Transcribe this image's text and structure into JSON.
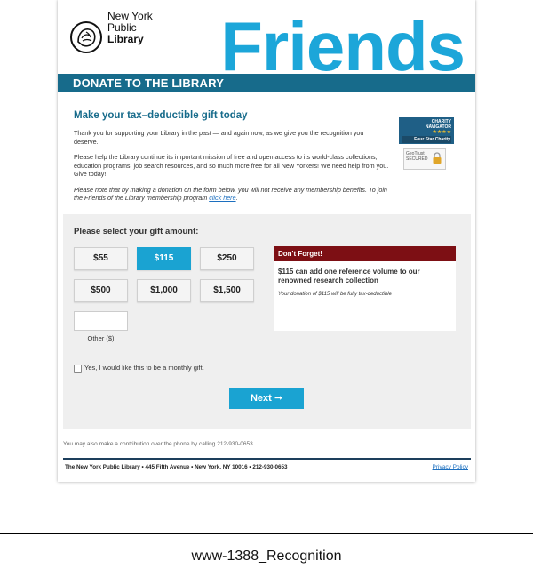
{
  "header": {
    "logo_line1": "New York",
    "logo_line2": "Public",
    "logo_line3": "Library",
    "hero_word": "Friends",
    "banner": "DONATE TO THE LIBRARY"
  },
  "intro": {
    "title": "Make your tax–deductible gift today",
    "p1": "Thank you for supporting your Library in the past — and again now, as we give you the recognition you deserve.",
    "p2": "Please help the Library continue its important mission of free and open access to its world-class collections, education programs, job search resources, and so much more free for all New Yorkers! We need help from you. Give today!",
    "note": "Please note that by making a donation on the form below, you will not receive any membership benefits. To join the Friends of the Library membership program",
    "link": "click here",
    "link_end": "."
  },
  "badges": {
    "charity_line1": "CHARITY",
    "charity_line2": "NAVIGATOR",
    "charity_stars": "★★★★",
    "charity_line3": "Four Star Charity",
    "secure_line1": "GeoTrust",
    "secure_line2": "SECURED"
  },
  "gift": {
    "title": "Please select your gift amount:",
    "amounts": [
      "$55",
      "$115",
      "$250",
      "$500",
      "$1,000",
      "$1,500"
    ],
    "selected": "$115",
    "other_label": "Other ($)",
    "monthly_label": "Yes, I would like this to be a monthly gift.",
    "next_label": "Next ➞"
  },
  "reminder": {
    "heading": "Don't Forget!",
    "message": "$115 can add one reference volume to our renowned research collection",
    "tax_note": "Your donation of $115 will be fully tax-deductible"
  },
  "footer": {
    "phone": "You may also make a contribution over the phone by calling 212-930-0653.",
    "address": "The New York Public Library • 445 Fifth Avenue • New York, NY 10016 • 212-930-0653",
    "privacy": "Privacy Policy"
  },
  "caption": "www-1388_Recognition",
  "colors": {
    "brand_blue": "#1ca6d9",
    "banner_teal": "#176b8b",
    "alert_red": "#7d0f14"
  }
}
